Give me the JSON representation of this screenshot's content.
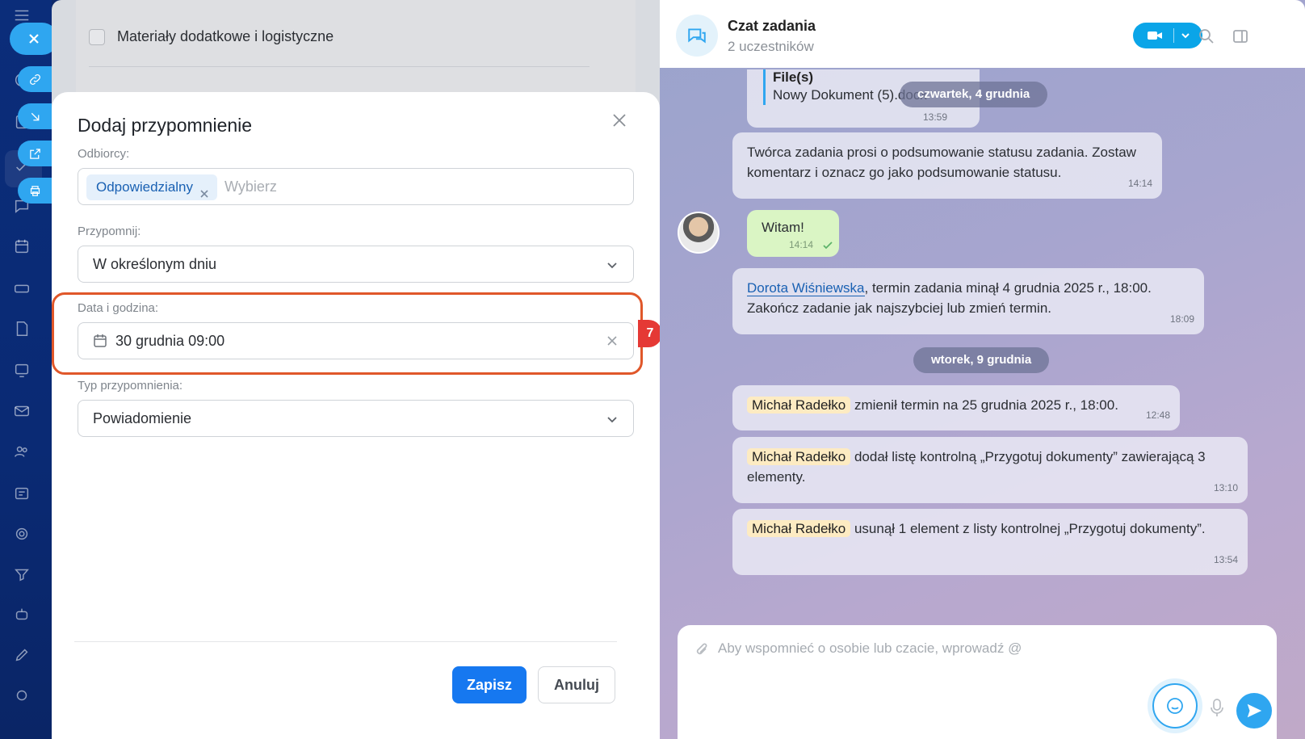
{
  "background_task": {
    "checklist_item": "Materiały dodatkowe i logistyczne"
  },
  "modal": {
    "title": "Dodaj przypomnienie",
    "recipients_label": "Odbiorcy:",
    "recipient_tag": "Odpowiedzialny",
    "recipients_placeholder": "Wybierz",
    "remind_label": "Przypomnij:",
    "remind_value": "W określonym dniu",
    "datetime_label": "Data i godzina:",
    "datetime_value": "30 grudnia 09:00",
    "type_label": "Typ przypomnienia:",
    "type_value": "Powiadomienie",
    "save_label": "Zapisz",
    "cancel_label": "Anuluj",
    "step_badge": "7"
  },
  "chat": {
    "title": "Czat zadania",
    "subtitle": "2 uczestników",
    "quote": {
      "title": "File(s)",
      "file": "Nowy Dokument (5).docx",
      "time": "13:59"
    },
    "date_1": "czwartek, 4 grudnia",
    "date_2": "wtorek, 9 grudnia",
    "messages": [
      {
        "text": "Twórca zadania prosi o podsumowanie statusu zadania. Zostaw komentarz i oznacz go jako podsumowanie statusu.",
        "time": "14:14"
      },
      {
        "text": "Witam!",
        "time": "14:14"
      },
      {
        "link": "Dorota Wiśniewska",
        "text": ", termin zadania minął 4 grudnia 2025 r., 18:00. Zakończ zadanie jak najszybciej lub zmień termin.",
        "time": "18:09"
      },
      {
        "mention": "Michał Radełko",
        "text": " zmienił termin na 25 grudnia 2025 r., 18:00.",
        "time": "12:48"
      },
      {
        "mention": "Michał Radełko",
        "text": " dodał listę kontrolną „Przygotuj dokumenty” zawierającą 3 elementy.",
        "time": "13:10"
      },
      {
        "mention": "Michał Radełko",
        "text": " usunął 1 element z listy kontrolnej „Przygotuj dokumenty”.",
        "time": "13:54"
      }
    ],
    "composer_placeholder": "Aby wspomnieć o osobie lub czacie, wprowadź @"
  },
  "colors": {
    "accent": "#1678f0",
    "highlight": "#e0572a",
    "badge": "#e53935"
  }
}
